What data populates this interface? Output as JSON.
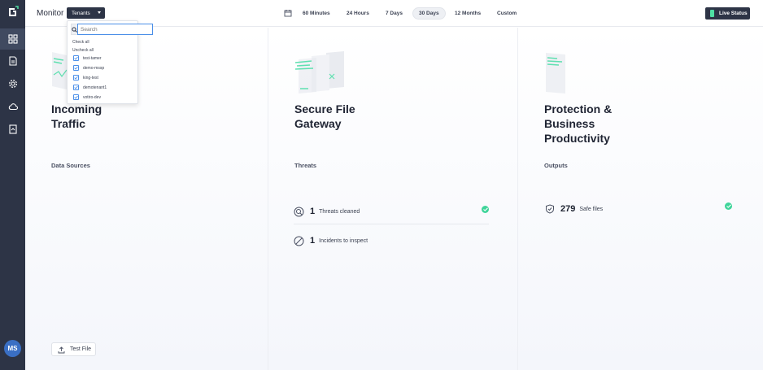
{
  "sidebar": {
    "logo": "logo-icon",
    "items": [
      {
        "name": "dashboard-icon",
        "active": true
      },
      {
        "name": "document-icon",
        "active": false
      },
      {
        "name": "gear-icon",
        "active": false
      },
      {
        "name": "cloud-icon",
        "active": false
      },
      {
        "name": "book-icon",
        "active": false
      }
    ],
    "avatar_initials": "MS"
  },
  "header": {
    "title": "Monitor",
    "tenants_label": "Tenants",
    "ranges": [
      {
        "label": "60 Minutes",
        "selected": false
      },
      {
        "label": "24 Hours",
        "selected": false
      },
      {
        "label": "7 Days",
        "selected": false
      },
      {
        "label": "30 Days",
        "selected": true
      },
      {
        "label": "12 Months",
        "selected": false
      },
      {
        "label": "Custom",
        "selected": false
      }
    ],
    "live_status_label": "Live Status"
  },
  "tenants_dropdown": {
    "search_placeholder": "Search",
    "check_all": "Check all",
    "uncheck_all": "Uncheck all",
    "tenants": [
      "test-tamer",
      "demo-mssp",
      "king-test",
      "demotenant1",
      "votiro-dev"
    ]
  },
  "cards": {
    "incoming": {
      "title_line1": "Incoming",
      "title_line2": "Traffic",
      "section": "Data Sources"
    },
    "gateway": {
      "title_line1": "Secure File",
      "title_line2": "Gateway",
      "section": "Threats"
    },
    "protection": {
      "title_line1": "Protection &",
      "title_line2": "Business",
      "title_line3": "Productivity",
      "section": "Outputs"
    }
  },
  "threats": [
    {
      "count": "1",
      "label": "Threats cleaned",
      "icon": "threat-scan-icon"
    },
    {
      "count": "1",
      "label": "Incidents to inspect",
      "icon": "blocked-icon"
    }
  ],
  "outputs": {
    "count": "279",
    "label": "Safe files",
    "icon": "shield-check-icon"
  },
  "test_file_label": "Test File",
  "colors": {
    "sidebar": "#2d3446",
    "accent_green": "#3fd49a",
    "live_indicator": "#4fe0a4",
    "focus_blue": "#4b8fe8"
  }
}
